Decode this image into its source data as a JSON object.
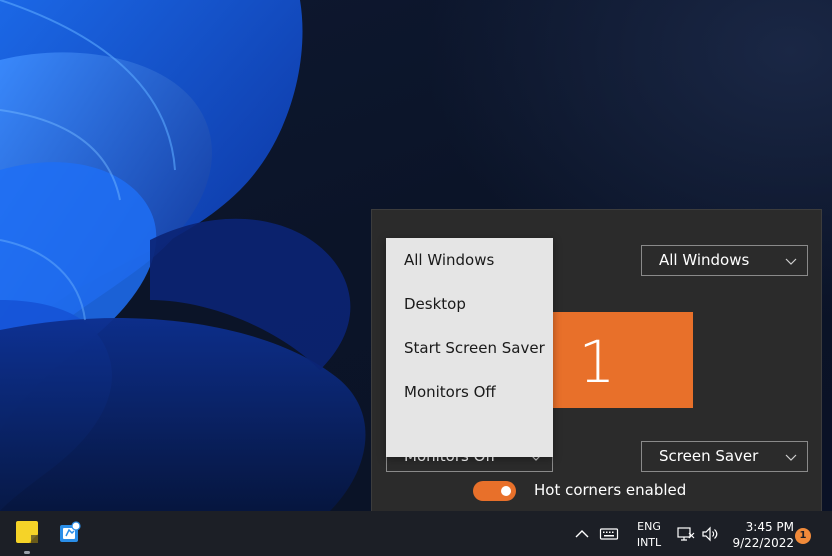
{
  "panel": {
    "top_right_select": {
      "value": "All Windows"
    },
    "bottom_left_select": {
      "value": "Monitors Off"
    },
    "bottom_right_select": {
      "value": "Screen Saver"
    },
    "monitor": {
      "number": "1",
      "color": "#e8702a"
    },
    "hot_corners": {
      "label": "Hot corners enabled",
      "enabled": true
    }
  },
  "dropdown": {
    "options": [
      "All Windows",
      "Desktop",
      "Start Screen Saver",
      "Monitors Off"
    ]
  },
  "taskbar": {
    "apps": [
      {
        "name": "sticky-notes",
        "icon": "sticky-notes-icon"
      },
      {
        "name": "app",
        "icon": "app-icon"
      }
    ],
    "tray": {
      "language_line1": "ENG",
      "language_line2": "INTL",
      "time": "3:45 PM",
      "date": "9/22/2022",
      "notification_count": "1"
    }
  },
  "colors": {
    "accent": "#e8702a",
    "panel_bg": "#2b2b2b",
    "dropdown_bg": "#e5e5e5",
    "taskbar_bg": "#1c1f26"
  }
}
